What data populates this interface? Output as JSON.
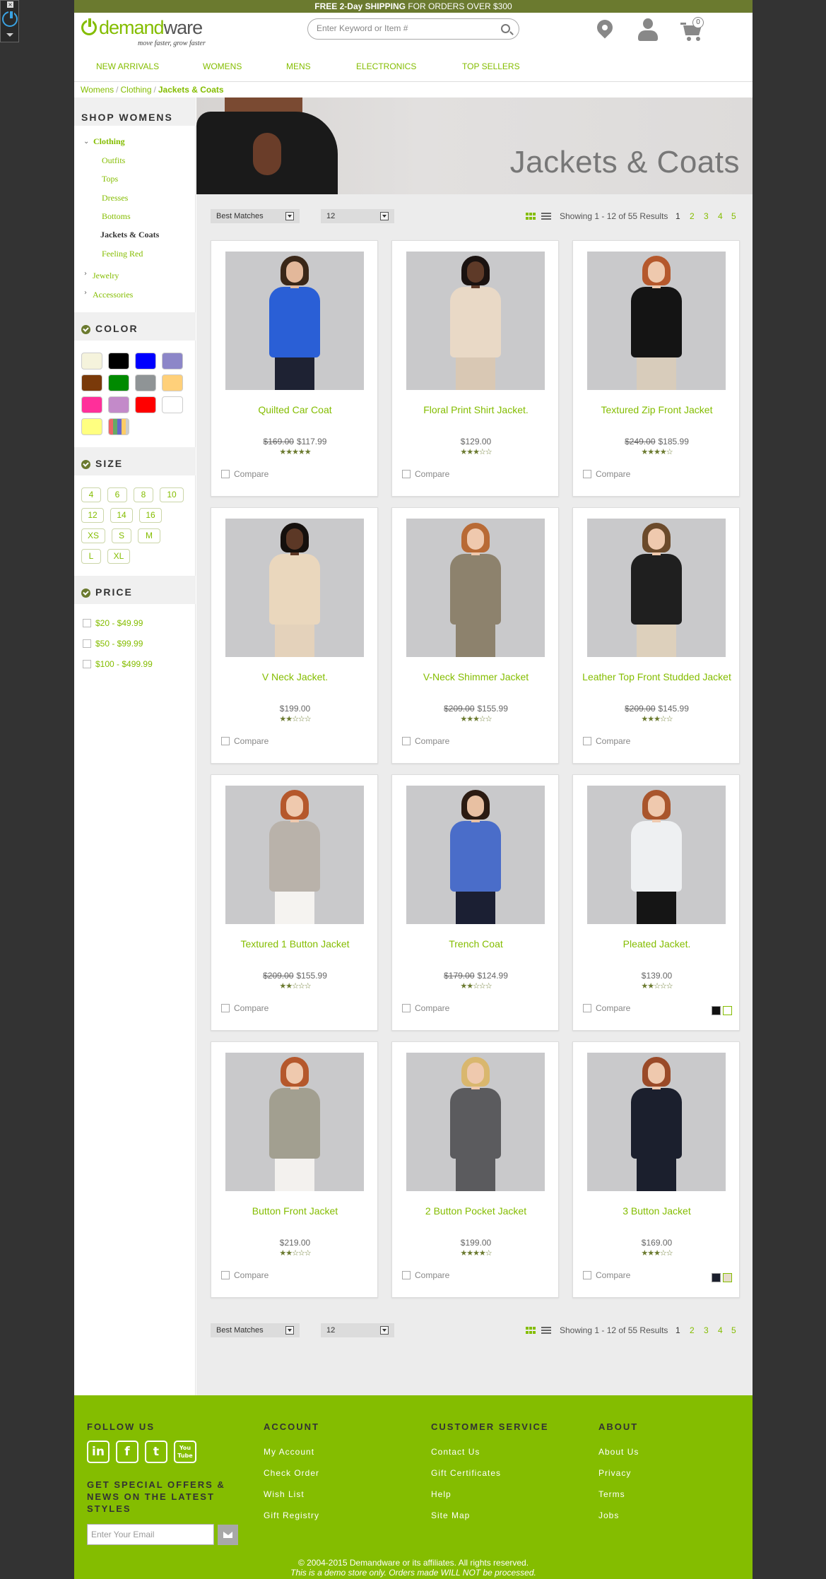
{
  "promo": {
    "bold": "FREE 2-Day SHIPPING",
    "rest": " FOR ORDERS OVER $300"
  },
  "brand": {
    "name_a": "demand",
    "name_b": "ware",
    "tagline": "move faster, grow faster",
    "accent": "#84bd00",
    "dark_accent": "#6b7a2f"
  },
  "search": {
    "placeholder": "Enter Keyword or Item #"
  },
  "cart": {
    "count": "0"
  },
  "nav": [
    "NEW ARRIVALS",
    "WOMENS",
    "MENS",
    "ELECTRONICS",
    "TOP SELLERS"
  ],
  "breadcrumb": [
    "Womens",
    "Clothing",
    "Jackets & Coats"
  ],
  "sidebar": {
    "title": "SHOP WOMENS",
    "category": "Clothing",
    "subcategories": [
      "Outfits",
      "Tops",
      "Dresses",
      "Bottoms",
      "Jackets & Coats",
      "Feeling Red"
    ],
    "other_categories": [
      "Jewelry",
      "Accessories"
    ],
    "color_title": "COLOR",
    "colors": [
      "#f5f3dc",
      "#000000",
      "#0000ff",
      "#8c86c8",
      "#7a3a0a",
      "#008a00",
      "#8f9496",
      "#ffd07a",
      "#ff2f9a",
      "#c38ac9",
      "#ff0000",
      "#ffffff",
      "#ffff80",
      "multicolor"
    ],
    "size_title": "SIZE",
    "sizes": [
      "4",
      "6",
      "8",
      "10",
      "12",
      "14",
      "16",
      "XS",
      "S",
      "M",
      "L",
      "XL"
    ],
    "price_title": "PRICE",
    "prices": [
      "$20 - $49.99",
      "$50 - $99.99",
      "$100 - $499.99"
    ]
  },
  "banner": {
    "title": "Jackets & Coats"
  },
  "toolbar": {
    "sort": "Best Matches",
    "per_page": "12",
    "results": "Showing 1 - 12 of 55 Results",
    "pages": [
      "1",
      "2",
      "3",
      "4",
      "5"
    ]
  },
  "compare_label": "Compare",
  "products": [
    {
      "name": "Quilted Car Coat",
      "old": "$169.00",
      "price": "$117.99",
      "stars": "★★★★★",
      "coat": "#2a5fd6",
      "hair": "#3a2718",
      "skin": "#e3b89a",
      "legs": "#1e2233"
    },
    {
      "name": "Floral Print Shirt Jacket.",
      "old": "",
      "price": "$129.00",
      "stars": "★★★☆☆",
      "coat": "#e9d9c6",
      "hair": "#1a1210",
      "skin": "#5e3a28",
      "legs": "#d9c8b4"
    },
    {
      "name": "Textured Zip Front Jacket",
      "old": "$249.00",
      "price": "$185.99",
      "stars": "★★★★☆",
      "coat": "#141414",
      "hair": "#b5582c",
      "skin": "#efc9ae",
      "legs": "#d8ccbb"
    },
    {
      "name": "V Neck Jacket.",
      "old": "",
      "price": "$199.00",
      "stars": "★★☆☆☆",
      "coat": "#ead7bd",
      "hair": "#15100d",
      "skin": "#5c3826",
      "legs": "#e4d2bb"
    },
    {
      "name": "V-Neck Shimmer Jacket",
      "old": "$209.00",
      "price": "$155.99",
      "stars": "★★★☆☆",
      "coat": "#8d826d",
      "hair": "#b86a35",
      "skin": "#efc9ae",
      "legs": "#8d826d"
    },
    {
      "name": "Leather Top Front Studded Jacket",
      "old": "$209.00",
      "price": "$145.99",
      "stars": "★★★☆☆",
      "coat": "#1f1f1f",
      "hair": "#6b4a2b",
      "skin": "#efc9ae",
      "legs": "#ddd0bc"
    },
    {
      "name": "Textured 1 Button Jacket",
      "old": "$209.00",
      "price": "$155.99",
      "stars": "★★☆☆☆",
      "coat": "#b9b2aa",
      "hair": "#b5582c",
      "skin": "#efc9ae",
      "legs": "#f5f3f0"
    },
    {
      "name": "Trench Coat",
      "old": "$179.00",
      "price": "$124.99",
      "stars": "★★☆☆☆",
      "coat": "#4a6dc9",
      "hair": "#2b1b12",
      "skin": "#e8c0a2",
      "legs": "#1b1f33"
    },
    {
      "name": "Pleated Jacket.",
      "old": "",
      "price": "$139.00",
      "stars": "★★☆☆☆",
      "coat": "#eef0f2",
      "hair": "#a9552c",
      "skin": "#efc9ae",
      "legs": "#151515",
      "swatches": [
        "#111111",
        "#ffffff"
      ]
    },
    {
      "name": "Button Front Jacket",
      "old": "",
      "price": "$219.00",
      "stars": "★★☆☆☆",
      "coat": "#a29f90",
      "hair": "#b5582c",
      "skin": "#efc9ae",
      "legs": "#f3f1ee"
    },
    {
      "name": "2 Button Pocket Jacket",
      "old": "",
      "price": "$199.00",
      "stars": "★★★★☆",
      "coat": "#5b5b5e",
      "hair": "#d9b76e",
      "skin": "#efc9ae",
      "legs": "#5b5b5e"
    },
    {
      "name": "3 Button Jacket",
      "old": "",
      "price": "$169.00",
      "stars": "★★★☆☆",
      "coat": "#1b1f2d",
      "hair": "#9a4a28",
      "skin": "#efc9ae",
      "legs": "#1b1f2d",
      "swatches": [
        "#1b1f2d",
        "#e6dccb"
      ]
    }
  ],
  "footer": {
    "follow": "FOLLOW US",
    "social": [
      "in",
      "f",
      "t",
      "You Tube"
    ],
    "offers": "GET SPECIAL OFFERS & NEWS ON THE LATEST STYLES",
    "email_placeholder": "Enter Your Email",
    "account_title": "ACCOUNT",
    "account": [
      "My Account",
      "Check Order",
      "Wish List",
      "Gift Registry"
    ],
    "service_title": "CUSTOMER SERVICE",
    "service": [
      "Contact Us",
      "Gift Certificates",
      "Help",
      "Site Map"
    ],
    "about_title": "ABOUT",
    "about": [
      "About Us",
      "Privacy",
      "Terms",
      "Jobs"
    ],
    "copyright": "© 2004-2015 Demandware or its affiliates. All rights reserved.",
    "demo": "This is a demo store only. Orders made WILL NOT be processed."
  }
}
